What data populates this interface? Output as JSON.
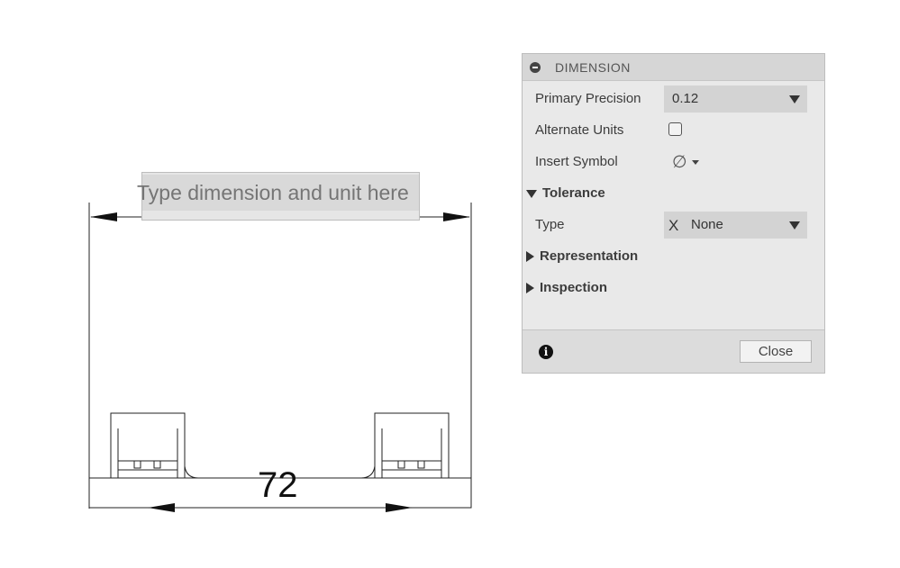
{
  "drawing": {
    "dimension_placeholder": "Type dimension and unit here",
    "bottom_dimension_value": "72"
  },
  "panel": {
    "title": "DIMENSION",
    "primary_precision": {
      "label": "Primary Precision",
      "value": "0.12"
    },
    "alternate_units": {
      "label": "Alternate Units",
      "checked": false
    },
    "insert_symbol": {
      "label": "Insert Symbol",
      "symbol": "∅"
    },
    "tolerance": {
      "label": "Tolerance",
      "expanded": true,
      "type": {
        "label": "Type",
        "icon_text": "X",
        "value": "None"
      }
    },
    "representation": {
      "label": "Representation",
      "expanded": false
    },
    "inspection": {
      "label": "Inspection",
      "expanded": false
    },
    "footer": {
      "info_icon": "info-icon",
      "close_label": "Close"
    }
  },
  "colors": {
    "panel_bg": "#e9e9e9",
    "panel_header_bg": "#d6d6d6",
    "select_bg": "#d3d3d3",
    "drawing_line": "#222222"
  }
}
